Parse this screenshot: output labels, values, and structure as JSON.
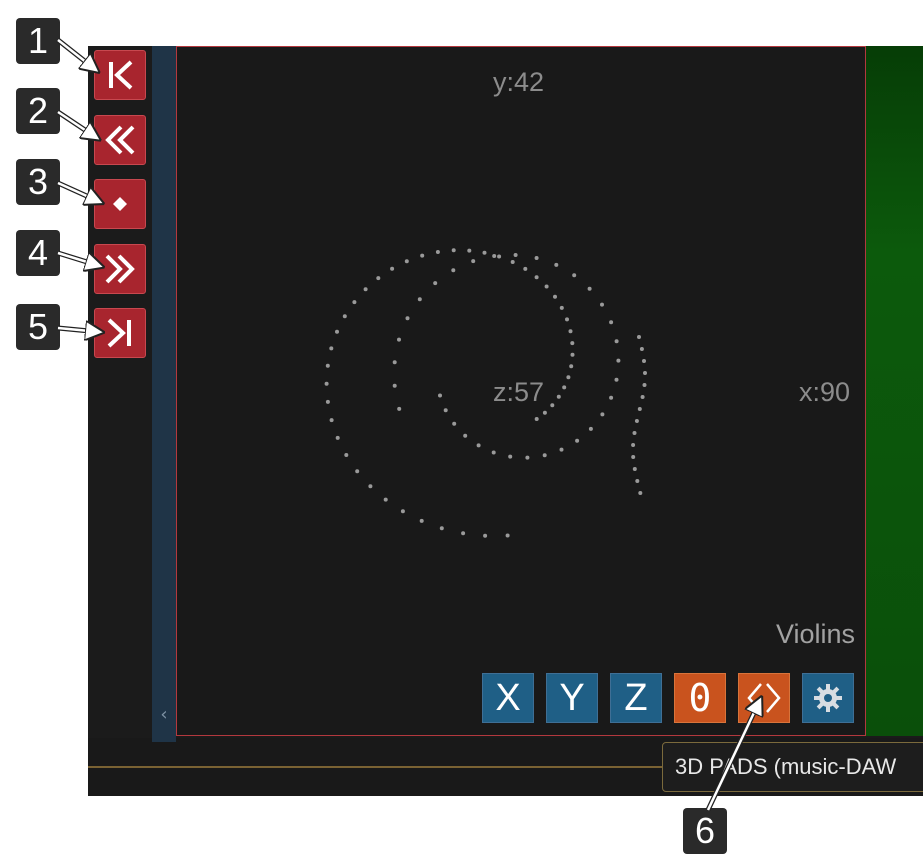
{
  "pad": {
    "y_label": "y:42",
    "z_label": "z:57",
    "x_label": "x:90",
    "instrument": "Violins"
  },
  "pad_buttons": {
    "x_label": "X",
    "y_label": "Y",
    "z_label": "Z",
    "zero_label": "0",
    "expand_icon": "expand-code-icon",
    "settings_icon": "gear-icon"
  },
  "tooltip": {
    "text": "3D PADS (music-DAW"
  },
  "transport": [
    {
      "icon": "go-to-start-icon"
    },
    {
      "icon": "rewind-icon"
    },
    {
      "icon": "record-position-icon"
    },
    {
      "icon": "fast-forward-icon"
    },
    {
      "icon": "go-to-end-icon"
    }
  ],
  "callouts": [
    "1",
    "2",
    "3",
    "4",
    "5",
    "6"
  ],
  "colors": {
    "transport_red": "#a8252e",
    "pad_border": "#b3383e",
    "axis_button_blue": "#1f5f86",
    "accent_orange": "#c9531e",
    "green_panel": "#0c5a0c"
  }
}
